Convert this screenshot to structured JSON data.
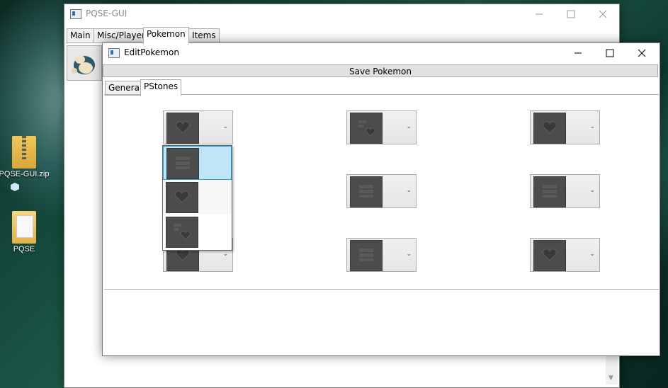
{
  "desktop": {
    "icons": [
      {
        "label": "PQSE-GUI.zip",
        "icon": "zip-folder-icon"
      },
      {
        "label": "PQSE",
        "icon": "folder-icon"
      }
    ]
  },
  "main_window": {
    "title": "PQSE-GUI",
    "tabs": [
      {
        "label": "Main"
      },
      {
        "label": "Misc/Player"
      },
      {
        "label": "Pokemon",
        "selected": true
      },
      {
        "label": "Items"
      }
    ],
    "controls": {
      "minimize": "minimize-icon",
      "maximize": "maximize-icon",
      "close": "close-icon"
    }
  },
  "edit_window": {
    "title": "EditPokemon",
    "save_button": "Save Pokemon",
    "tabs": [
      {
        "label": "General"
      },
      {
        "label": "PStones",
        "selected": true
      }
    ],
    "stone_slots": [
      {
        "icon": "heart-stone-icon"
      },
      {
        "icon": "swap-heart-stone-icon"
      },
      {
        "icon": "heart-stone-icon"
      },
      {
        "icon": "attack-stone-icon"
      },
      {
        "icon": "attack-stone-icon"
      },
      {
        "icon": "heart-stone-icon"
      },
      {
        "icon": "attack-stone-icon"
      },
      {
        "icon": "heart-stone-icon"
      }
    ],
    "dropdown": {
      "options": [
        {
          "icon": "attack-stone-icon",
          "highlighted": true
        },
        {
          "icon": "heart-stone-icon"
        },
        {
          "icon": "swap-heart-stone-icon"
        }
      ]
    }
  },
  "colors": {
    "highlight": "#bee6f8",
    "highlight_border": "#26a0da",
    "stone_bg": "#4c4c4c"
  }
}
